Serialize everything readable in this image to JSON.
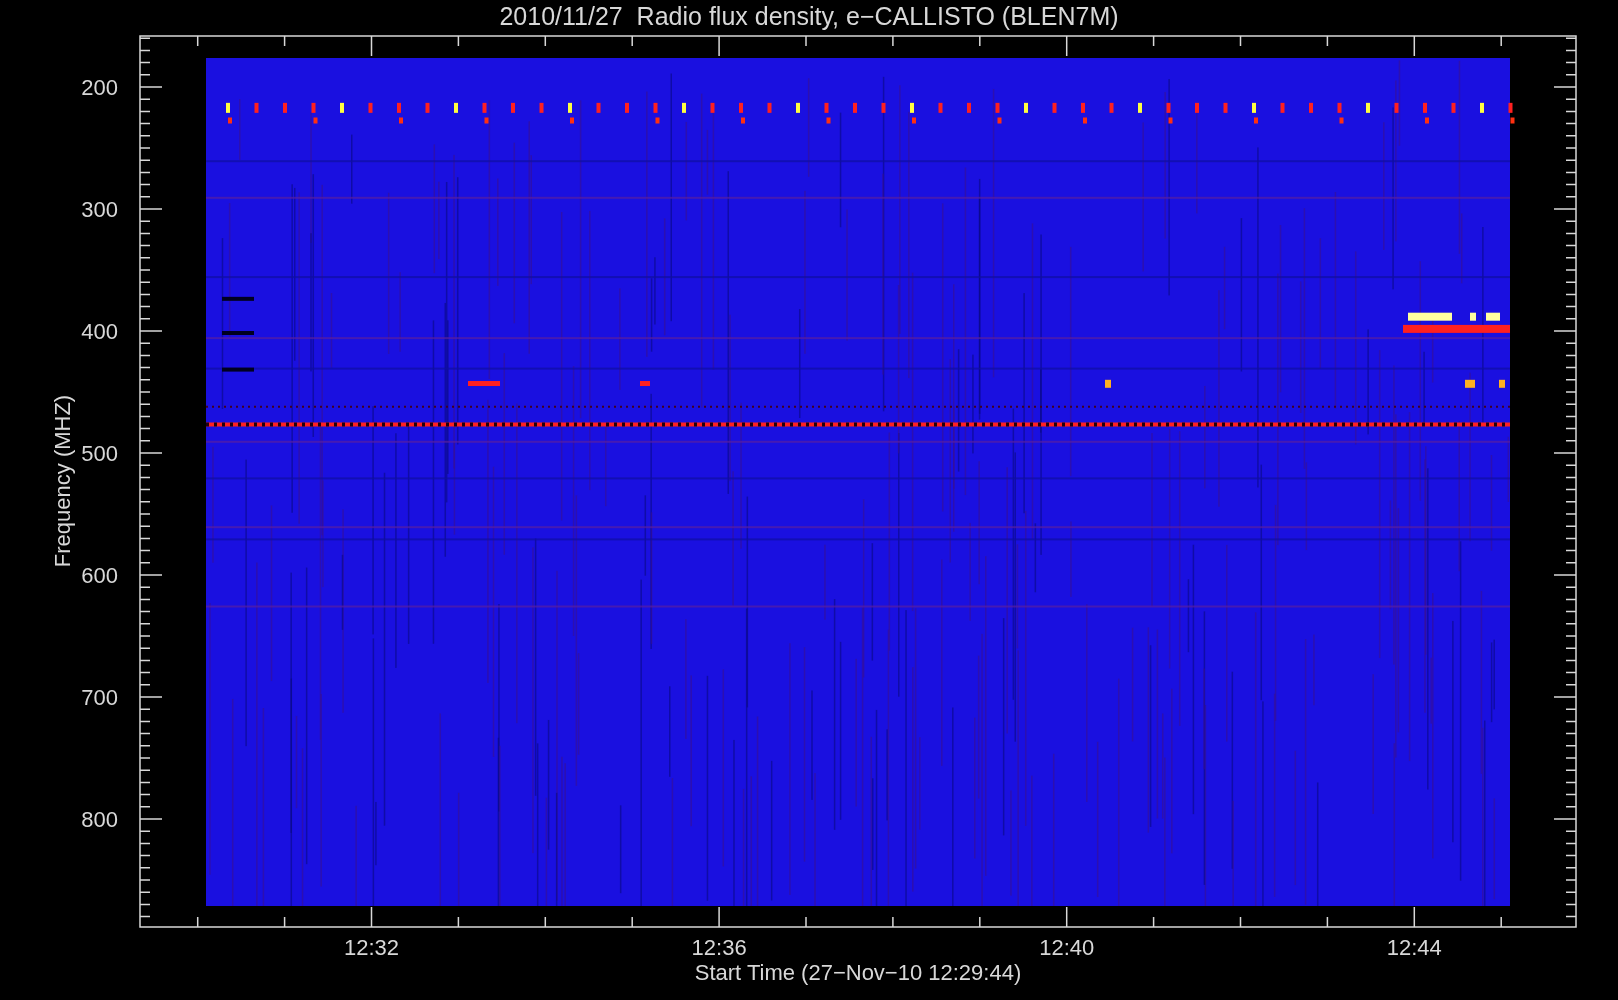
{
  "title": "2010/11/27  Radio flux density, e−CALLISTO (BLEN7M)",
  "y_axis": {
    "label": "Frequency (MHZ)",
    "ticks": [
      "200",
      "300",
      "400",
      "500",
      "600",
      "700",
      "800"
    ]
  },
  "x_axis": {
    "label": "Start Time (27−Nov−10 12:29:44)",
    "ticks": [
      "12:32",
      "12:36",
      "12:40",
      "12:44"
    ]
  }
}
